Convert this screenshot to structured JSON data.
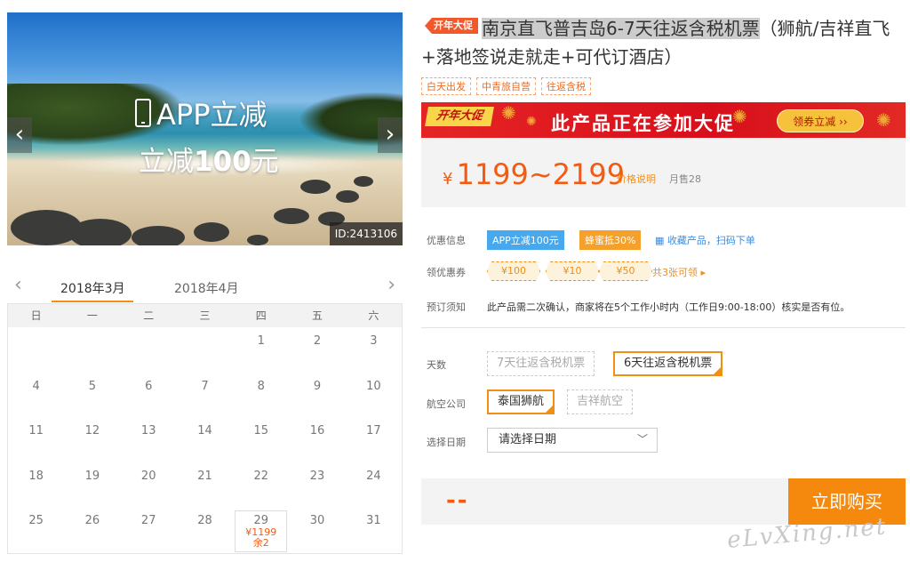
{
  "banner": {
    "app_text": "APP立减",
    "minus_text_prefix": "立减",
    "minus_amount": "100",
    "minus_unit": "元",
    "id_label": "ID:2413106",
    "prev_glyph": "‹",
    "next_glyph": "›"
  },
  "calendar": {
    "prev_glyph": "‹",
    "next_glyph": "›",
    "months": [
      "2018年3月",
      "2018年4月"
    ],
    "active_month_index": 0,
    "weekdays": [
      "日",
      "一",
      "二",
      "三",
      "四",
      "五",
      "六"
    ],
    "days": [
      "",
      "",
      "",
      "",
      "1",
      "2",
      "3",
      "4",
      "5",
      "6",
      "7",
      "8",
      "9",
      "10",
      "11",
      "12",
      "13",
      "14",
      "15",
      "16",
      "17",
      "18",
      "19",
      "20",
      "21",
      "22",
      "23",
      "24",
      "25",
      "26",
      "27",
      "28",
      "29",
      "30",
      "31"
    ],
    "special_day": {
      "day": "29",
      "price": "¥1199",
      "remain": "余2"
    }
  },
  "product": {
    "badge": "开年大促",
    "title_highlight": "南京直飞普吉岛6-7天往返含税机票",
    "title_rest": "（狮航/吉祥直飞+落地签说走就走+可代订酒店）",
    "tags": [
      "白天出发",
      "中青旅自营",
      "往返含税"
    ]
  },
  "promo": {
    "badge": "开年大促",
    "text": "此产品正在参加大促",
    "button": "领券立减 ››"
  },
  "price": {
    "yen": "¥",
    "range": "1199~2199",
    "info_link": "价格说明",
    "monthly_sales": "月售28"
  },
  "discounts": {
    "label": "优惠信息",
    "chip_app": "APP立减100元",
    "chip_honey": "蜂蜜抵30%",
    "fav_link": "收藏产品，扫码下单"
  },
  "coupons": {
    "label": "领优惠券",
    "items": [
      "¥100",
      "¥10",
      "¥50"
    ],
    "more": "共3张可领 ▸"
  },
  "notice": {
    "label": "预订须知",
    "text": "此产品需二次确认，商家将在5个工作小时内（工作日9:00-18:00）核实是否有位。"
  },
  "options": {
    "days_label": "天数",
    "days": [
      "7天往返含税机票",
      "6天往返含税机票"
    ],
    "days_selected": 1,
    "airline_label": "航空公司",
    "airlines": [
      "泰国狮航",
      "吉祥航空"
    ],
    "airline_selected": 0,
    "date_label": "选择日期",
    "date_placeholder": "请选择日期"
  },
  "footer": {
    "total": "--",
    "buy_button": "立即购买"
  },
  "watermark": "eLvXing.net",
  "colors": {
    "accent": "#f08e16",
    "price": "#f35b12",
    "promo_red": "#d80f1b",
    "chip_blue": "#48a8ee"
  }
}
